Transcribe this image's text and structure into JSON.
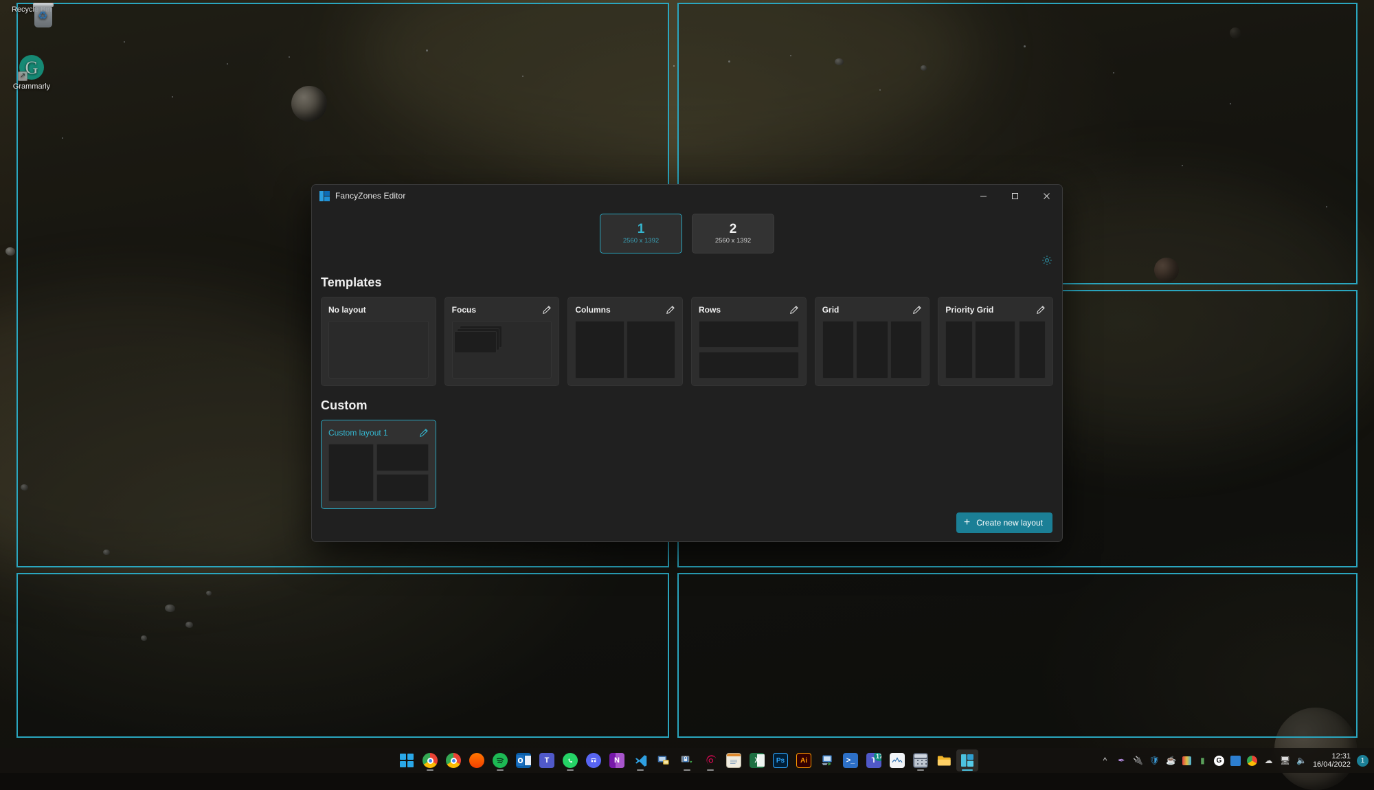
{
  "desktop": {
    "icons": [
      {
        "name": "Recycle Bin",
        "icon": "recycle-bin-icon"
      },
      {
        "name": "Grammarly",
        "icon": "grammarly-icon"
      }
    ],
    "zone_overlay_color": "#2aa6bf"
  },
  "window": {
    "title": "FancyZones Editor",
    "app_icon": "fancyzones-icon",
    "controls": {
      "minimize": "—",
      "maximize": "☐",
      "close": "✕"
    }
  },
  "monitors": {
    "settings_icon": "gear-icon",
    "items": [
      {
        "number": "1",
        "resolution": "2560 x 1392",
        "selected": true
      },
      {
        "number": "2",
        "resolution": "2560 x 1392",
        "selected": false
      }
    ]
  },
  "templates": {
    "heading": "Templates",
    "items": [
      {
        "name": "No layout",
        "editable": false,
        "preview": "none"
      },
      {
        "name": "Focus",
        "editable": true,
        "preview": "focus"
      },
      {
        "name": "Columns",
        "editable": true,
        "preview": "columns2"
      },
      {
        "name": "Rows",
        "editable": true,
        "preview": "rows2"
      },
      {
        "name": "Grid",
        "editable": true,
        "preview": "grid3"
      },
      {
        "name": "Priority Grid",
        "editable": true,
        "preview": "priority3"
      }
    ]
  },
  "custom": {
    "heading": "Custom",
    "items": [
      {
        "name": "Custom layout 1",
        "editable": true,
        "preview": "custom1",
        "selected": true
      }
    ]
  },
  "footer": {
    "create_label": "Create new layout",
    "create_icon": "plus-icon",
    "accent_color": "#1b7f96"
  },
  "taskbar": {
    "apps": [
      {
        "name": "Start",
        "icon": "windows-start-icon",
        "running": false,
        "active": false
      },
      {
        "name": "Google Chrome",
        "icon": "chrome-icon",
        "running": true,
        "active": false
      },
      {
        "name": "Google Chrome",
        "icon": "chrome-icon",
        "running": false,
        "active": false
      },
      {
        "name": "SoundCloud",
        "icon": "soundcloud-icon",
        "running": false,
        "active": false
      },
      {
        "name": "Spotify",
        "icon": "spotify-icon",
        "running": true,
        "active": false
      },
      {
        "name": "Outlook",
        "icon": "outlook-icon",
        "running": false,
        "active": false
      },
      {
        "name": "Microsoft Teams",
        "icon": "teams-icon",
        "running": false,
        "active": false
      },
      {
        "name": "WhatsApp",
        "icon": "whatsapp-icon",
        "running": true,
        "active": false
      },
      {
        "name": "Discord",
        "icon": "discord-icon",
        "running": false,
        "active": false
      },
      {
        "name": "OneNote",
        "icon": "onenote-icon",
        "running": false,
        "active": false
      },
      {
        "name": "Visual Studio Code",
        "icon": "vscode-icon",
        "running": true,
        "active": false
      },
      {
        "name": "Remote Desktop",
        "icon": "remote-desktop-icon",
        "running": false,
        "active": false
      },
      {
        "name": "Remote Desktop Secure",
        "icon": "rdp-secure-icon",
        "running": true,
        "active": false
      },
      {
        "name": "Debian",
        "icon": "debian-icon",
        "running": true,
        "active": false
      },
      {
        "name": "Notepad",
        "icon": "notepad-icon",
        "running": false,
        "active": false
      },
      {
        "name": "Excel",
        "icon": "excel-icon",
        "running": false,
        "active": false
      },
      {
        "name": "Photoshop",
        "icon": "photoshop-icon",
        "running": false,
        "active": false
      },
      {
        "name": "Illustrator",
        "icon": "illustrator-icon",
        "running": false,
        "active": false
      },
      {
        "name": "Remote Desktop Connection",
        "icon": "rdc-icon",
        "running": false,
        "active": false
      },
      {
        "name": "PowerShell",
        "icon": "powershell-icon",
        "running": false,
        "active": false
      },
      {
        "name": "Teams Classic",
        "icon": "teams-classic-icon",
        "running": false,
        "active": false,
        "badge": "17"
      },
      {
        "name": "Task Manager",
        "icon": "task-manager-icon",
        "running": false,
        "active": false
      },
      {
        "name": "Calculator",
        "icon": "calculator-icon",
        "running": true,
        "active": false
      },
      {
        "name": "File Explorer",
        "icon": "file-explorer-icon",
        "running": false,
        "active": false
      },
      {
        "name": "PowerToys",
        "icon": "powertoys-icon",
        "running": true,
        "active": true
      }
    ],
    "tray": {
      "icons": [
        "chevron-up-icon",
        "pen-icon",
        "usb-icon",
        "defender-icon",
        "cup-icon",
        "colors-icon",
        "money-icon",
        "grammarly-tray-icon",
        "onedrive-blue-icon",
        "chrome-tray-icon",
        "onedrive-icon",
        "display-icon",
        "volume-icon"
      ],
      "time": "12:31",
      "date": "16/04/2022",
      "notification_count": "1"
    }
  }
}
